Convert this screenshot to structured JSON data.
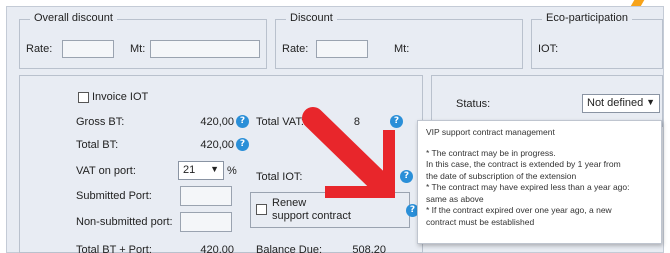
{
  "overall_discount": {
    "title": "Overall discount",
    "rate_label": "Rate:",
    "mt_label": "Mt:"
  },
  "discount": {
    "title": "Discount",
    "rate_label": "Rate:",
    "mt_label": "Mt:"
  },
  "eco": {
    "title": "Eco-participation",
    "iot_label": "IOT:"
  },
  "left": {
    "invoice_iot": "Invoice IOT",
    "gross_bt_label": "Gross BT:",
    "gross_bt_value": "420,00",
    "total_bt_label": "Total BT:",
    "total_bt_value": "420,00",
    "vat_port_label": "VAT on port:",
    "vat_port_value": "21",
    "percent": "%",
    "submitted_port_label": "Submitted Port:",
    "non_submitted_port_label": "Non-submitted port:",
    "total_bt_port_label": "Total BT + Port:",
    "total_bt_port_value": "420,00"
  },
  "middle": {
    "total_vat_label": "Total VAT:",
    "total_vat_value": "8",
    "total_iot_label": "Total IOT:",
    "renew_label_1": "Renew",
    "renew_label_2": "support contract",
    "balance_due_label": "Balance Due:",
    "balance_due_value": "508,20"
  },
  "status": {
    "label": "Status:",
    "value": "Not defined"
  },
  "tooltip": {
    "title": "VIP support contract management",
    "line1": "* The contract may be in progress.",
    "line2": "In this case, the contract is extended by 1 year from",
    "line3": "the date of subscription of the extension",
    "line4": "* The contract may have expired less than a year ago:",
    "line5": "same as above",
    "line6": "* If the contract expired over one year ago, a new",
    "line7": "contract must be established"
  },
  "info_glyph": "?",
  "colors": {
    "info": "#2a8fd8",
    "arrow": "#e8262b",
    "accent_orange": "#f7a31a"
  }
}
